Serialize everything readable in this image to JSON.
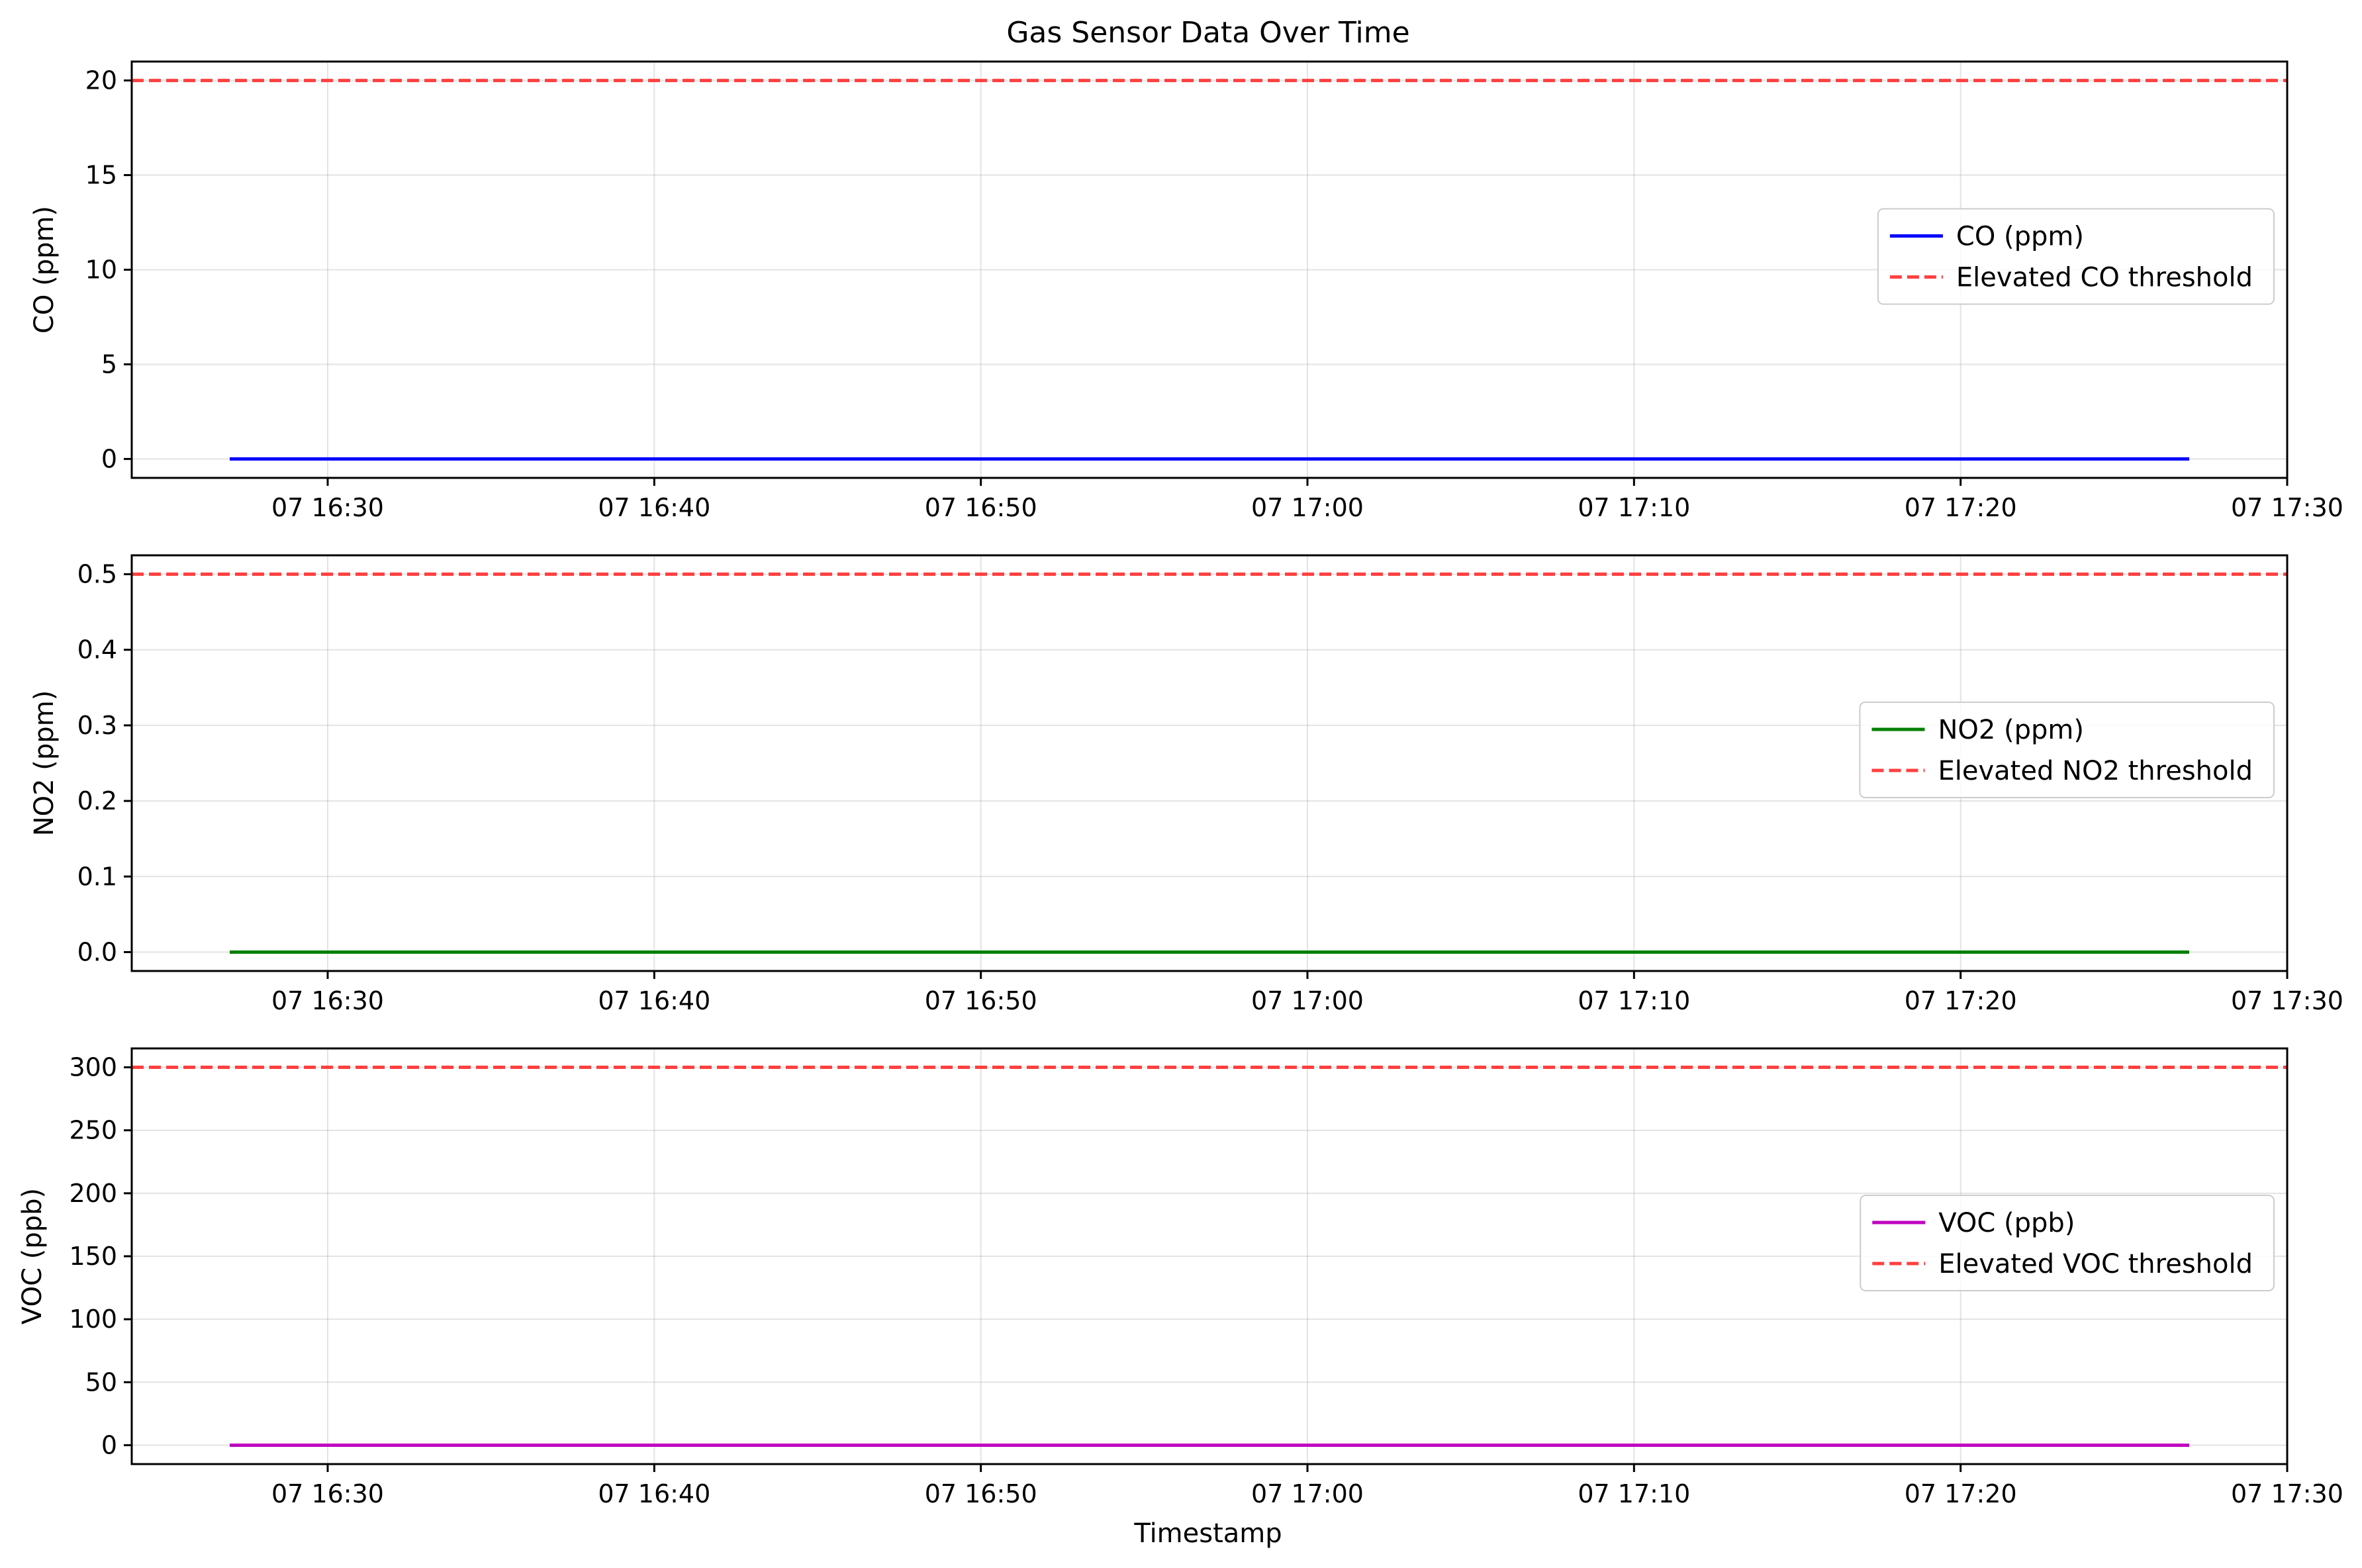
{
  "chart_data": {
    "title": "Gas Sensor Data Over Time",
    "xlabel": "Timestamp",
    "x_tick_labels": [
      "07 16:30",
      "07 16:40",
      "07 16:50",
      "07 17:00",
      "07 17:10",
      "07 17:20",
      "07 17:30"
    ],
    "x_tick_values": [
      "16:30",
      "16:40",
      "16:50",
      "17:00",
      "17:10",
      "17:20",
      "17:30"
    ],
    "xlim": [
      "16:24",
      "17:30"
    ],
    "grid": true,
    "panels": [
      {
        "type": "line",
        "ylabel": "CO (ppm)",
        "ylim": [
          -1,
          21
        ],
        "yticks": [
          0,
          5,
          10,
          15,
          20
        ],
        "series": [
          {
            "name": "CO (ppm)",
            "color": "#0000ff",
            "style": "solid",
            "x": [
              "16:27",
              "17:27"
            ],
            "y": [
              0,
              0
            ]
          },
          {
            "name": "Elevated CO threshold",
            "color": "#ff4040",
            "style": "dashed",
            "y_constant": 20
          }
        ],
        "legend_position": "center-right"
      },
      {
        "type": "line",
        "ylabel": "NO2 (ppm)",
        "ylim": [
          -0.025,
          0.525
        ],
        "yticks": [
          0.0,
          0.1,
          0.2,
          0.3,
          0.4,
          0.5
        ],
        "ytick_labels": [
          "0.0",
          "0.1",
          "0.2",
          "0.3",
          "0.4",
          "0.5"
        ],
        "series": [
          {
            "name": "NO2 (ppm)",
            "color": "#008000",
            "style": "solid",
            "x": [
              "16:27",
              "17:27"
            ],
            "y": [
              0,
              0
            ]
          },
          {
            "name": "Elevated NO2 threshold",
            "color": "#ff4040",
            "style": "dashed",
            "y_constant": 0.5
          }
        ],
        "legend_position": "center-right"
      },
      {
        "type": "line",
        "ylabel": "VOC (ppb)",
        "ylim": [
          -15,
          315
        ],
        "yticks": [
          0,
          50,
          100,
          150,
          200,
          250,
          300
        ],
        "series": [
          {
            "name": "VOC (ppb)",
            "color": "#bf00bf",
            "style": "solid",
            "x": [
              "16:27",
              "17:27"
            ],
            "y": [
              0,
              0
            ]
          },
          {
            "name": "Elevated VOC threshold",
            "color": "#ff4040",
            "style": "dashed",
            "y_constant": 300
          }
        ],
        "legend_position": "center-right"
      }
    ]
  }
}
